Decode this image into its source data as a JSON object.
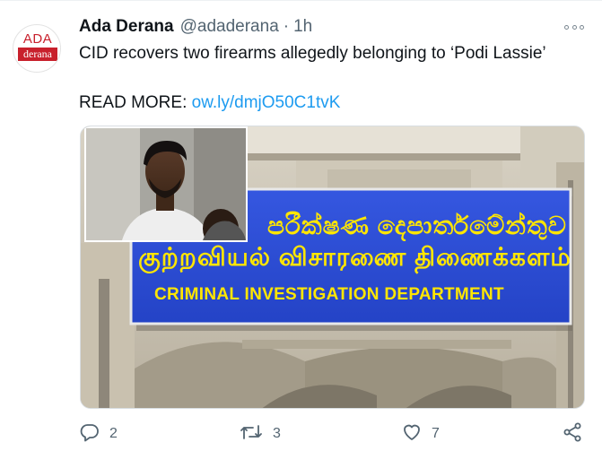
{
  "tweet": {
    "author_name": "Ada Derana",
    "author_handle": "@adaderana",
    "separator": "·",
    "time": "1h",
    "avatar_logo_top": "ADA",
    "avatar_logo_bottom": "derana",
    "text": "CID recovers two firearms allegedly belonging to ‘Podi Lassie’",
    "read_more_label": "READ MORE:",
    "link_text": "ow.ly/dmjO50C1tvK",
    "more_icon": "more-horizontal-icon"
  },
  "media": {
    "sign_sinhala": "පරීක්ෂණ දෙපාර්තමේන්තුව",
    "sign_tamil": "குற்றவியல் விசாரணை திணைக்களம்",
    "sign_english": "CRIMINAL INVESTIGATION DEPARTMENT",
    "sign_color": "#2f4fd6",
    "sign_text_color": "#ffe600"
  },
  "actions": {
    "reply_count": "2",
    "retweet_count": "3",
    "like_count": "7",
    "reply_icon": "reply-icon",
    "retweet_icon": "retweet-icon",
    "like_icon": "heart-icon",
    "share_icon": "share-icon"
  },
  "colors": {
    "accent": "#1d9bf0",
    "secondary_text": "#536471",
    "brand_red": "#c8202c"
  }
}
